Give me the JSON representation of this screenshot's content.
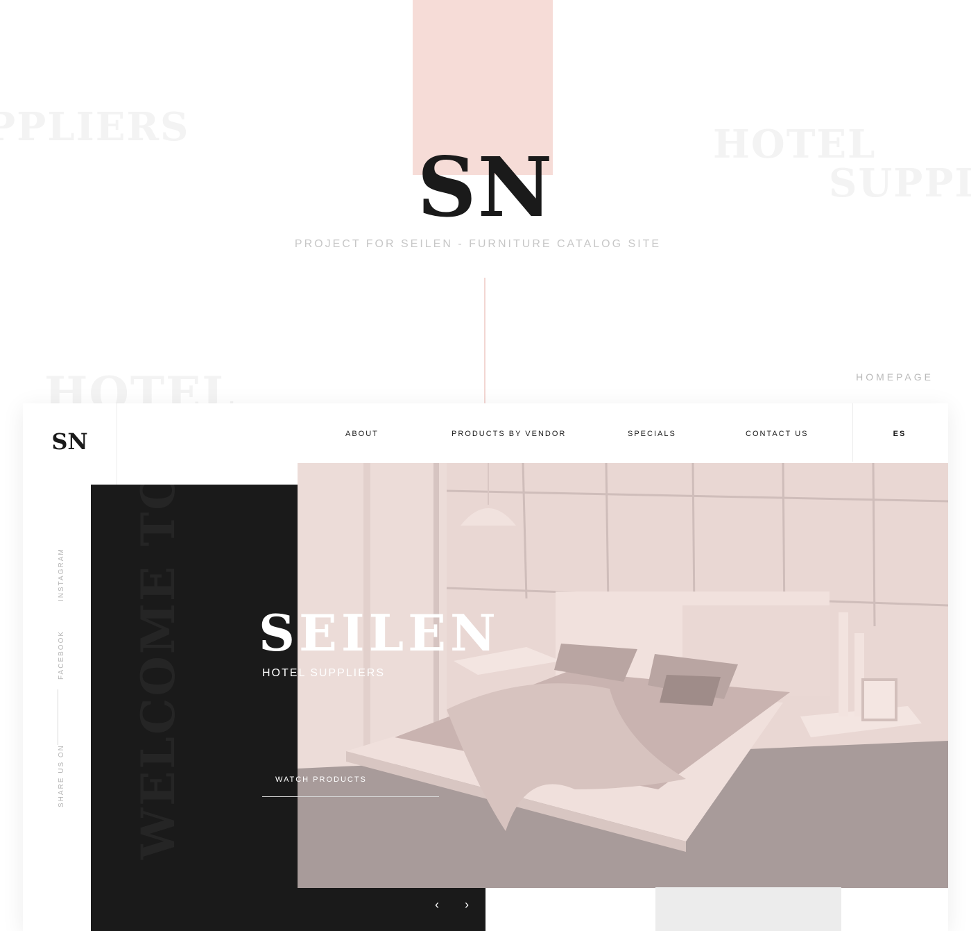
{
  "presentation": {
    "ghost_words": [
      "PPLIERS",
      "HOTEL",
      "SUPPLI",
      "HOTEL"
    ],
    "logo_text": "SN",
    "caption": "PROJECT FOR SEILEN - FURNITURE CATALOG SITE",
    "section_label": "HOMEPAGE"
  },
  "site": {
    "logo_text": "SN",
    "nav": {
      "about": "ABOUT",
      "products_by_vendor": "PRODUCTS BY VENDOR",
      "specials": "SPECIALS",
      "contact_us": "CONTACT US"
    },
    "language": "ES",
    "social": {
      "instagram": "INSTAGRAM",
      "facebook": "FACEBOOK",
      "share_label": "SHARE US ON"
    },
    "hero": {
      "welcome": "WELCOME TO",
      "brand": "SEILEN",
      "tagline": "HOTEL SUPPLIERS",
      "cta": "WATCH PRODUCTS",
      "prev_icon": "chevron-left-icon",
      "next_icon": "chevron-right-icon"
    }
  },
  "colors": {
    "accent_pink": "#f6dcd7",
    "dark_panel": "#1a1a1a",
    "text_dark": "#1a1a1a",
    "muted_grey": "#c7c7c7"
  }
}
